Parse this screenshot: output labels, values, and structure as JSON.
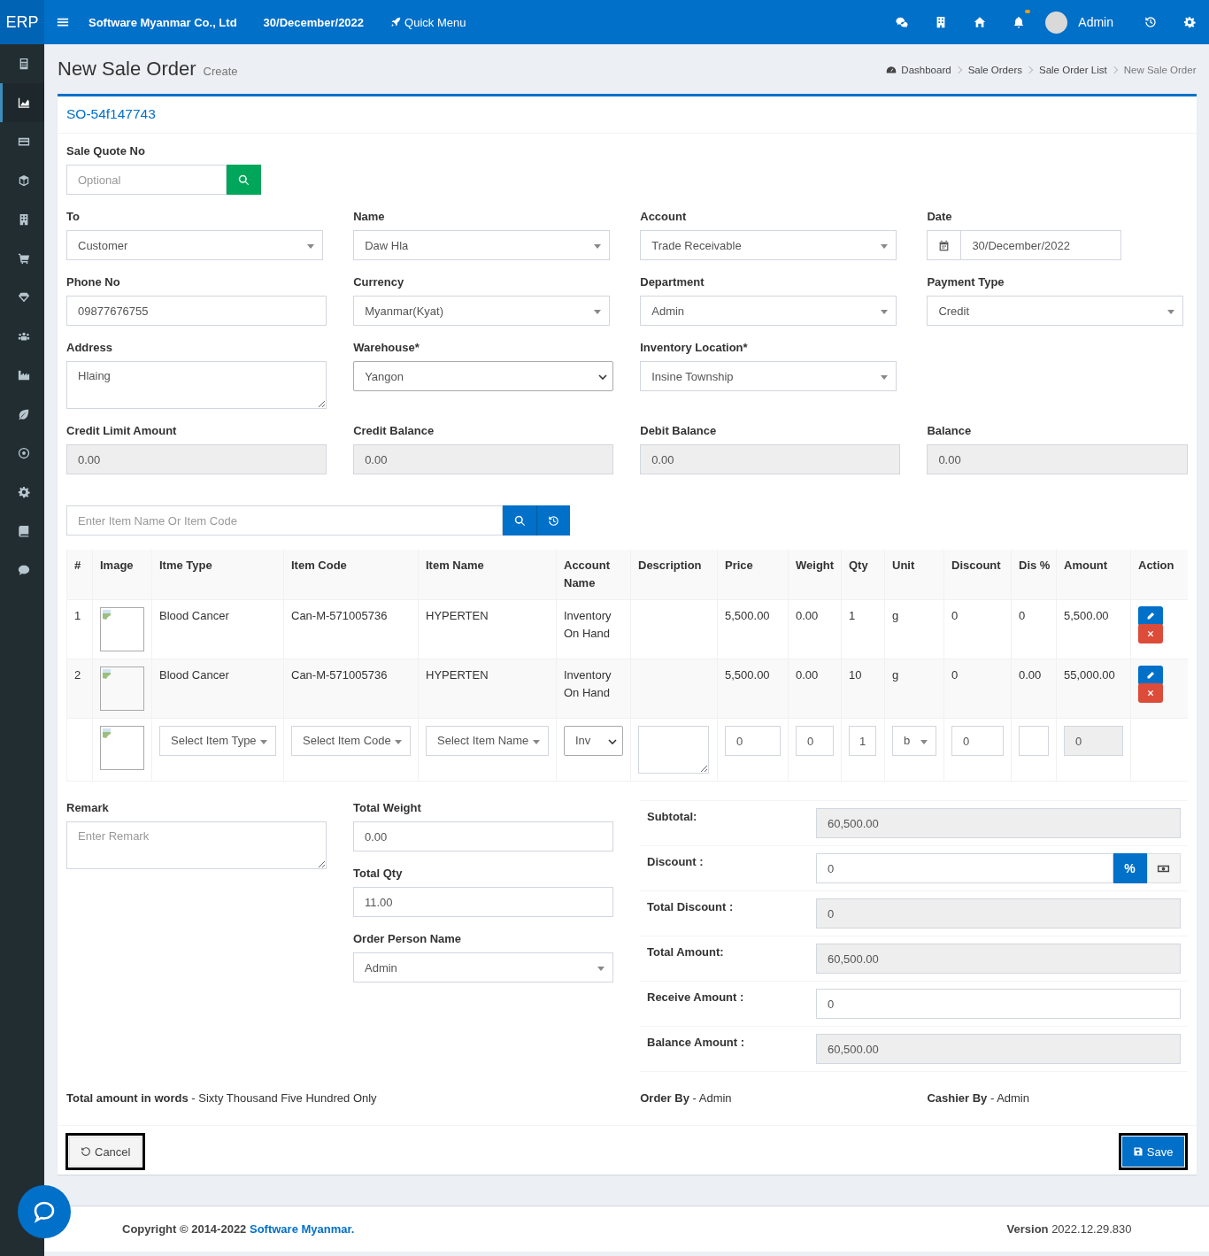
{
  "header": {
    "brand": "ERP",
    "company": "Software Myanmar Co., Ltd",
    "date": "30/December/2022",
    "quick_menu": "Quick Menu",
    "user": "Admin"
  },
  "sidebar": {
    "items": [
      {
        "kind": "calculator",
        "selected": false
      },
      {
        "kind": "area-chart",
        "selected": true
      },
      {
        "kind": "credit-card",
        "selected": false
      },
      {
        "kind": "cube",
        "selected": false
      },
      {
        "kind": "building",
        "selected": false
      },
      {
        "kind": "cart",
        "selected": false
      },
      {
        "kind": "diamond",
        "selected": false
      },
      {
        "kind": "users",
        "selected": false
      },
      {
        "kind": "factory",
        "selected": false
      },
      {
        "kind": "leaf",
        "selected": false
      },
      {
        "kind": "ball",
        "selected": false
      },
      {
        "kind": "gear",
        "selected": false
      },
      {
        "kind": "book",
        "selected": false
      },
      {
        "kind": "comment",
        "selected": false
      }
    ]
  },
  "page": {
    "title": "New Sale Order",
    "subtitle": "Create",
    "breadcrumb": [
      "Dashboard",
      "Sale Orders",
      "Sale Order List",
      "New Sale Order"
    ]
  },
  "order_no": "SO-54f147743",
  "sale_quote": {
    "label": "Sale Quote No",
    "placeholder": "Optional"
  },
  "field_rows": [
    [
      {
        "label": "To",
        "kind": "select",
        "value": "Customer"
      },
      {
        "label": "Name",
        "kind": "select",
        "value": "Daw Hla"
      },
      {
        "label": "Account",
        "kind": "select",
        "value": "Trade Receivable"
      },
      {
        "label": "Date",
        "kind": "date",
        "value": "30/December/2022"
      }
    ],
    [
      {
        "label": "Phone No",
        "kind": "input",
        "value": "09877676755"
      },
      {
        "label": "Currency",
        "kind": "select",
        "value": "Myanmar(Kyat)"
      },
      {
        "label": "Department",
        "kind": "select",
        "value": "Admin"
      },
      {
        "label": "Payment Type",
        "kind": "select",
        "value": "Credit"
      }
    ],
    [
      {
        "label": "Address",
        "kind": "textarea",
        "value": "Hlaing"
      },
      {
        "label": "Warehouse*",
        "kind": "native",
        "value": "Yangon"
      },
      {
        "label": "Inventory Location*",
        "kind": "select",
        "value": "Insine Township"
      }
    ],
    [
      {
        "label": "Credit Limit Amount",
        "kind": "readonly",
        "value": "0.00"
      },
      {
        "label": "Credit Balance",
        "kind": "readonly",
        "value": "0.00"
      },
      {
        "label": "Debit Balance",
        "kind": "readonly",
        "value": "0.00"
      },
      {
        "label": "Balance",
        "kind": "readonly",
        "value": "0.00"
      }
    ]
  ],
  "item_search": {
    "placeholder": "Enter Item Name Or Item Code"
  },
  "table": {
    "columns": [
      "#",
      "Image",
      "Itme Type",
      "Item Code",
      "Item Name",
      "Account Name",
      "Description",
      "Price",
      "Weight",
      "Qty",
      "Unit",
      "Discount",
      "Dis %",
      "Amount",
      "Action"
    ],
    "rows": [
      {
        "no": "1",
        "item_type": "Blood Cancer",
        "item_code": "Can-M-571005736",
        "item_name": "HYPERTEN",
        "account": "Inventory On Hand",
        "price": "5,500.00",
        "weight": "0.00",
        "qty": "1",
        "unit": "g",
        "discount": "0",
        "dis_percent": "0",
        "amount": "5,500.00"
      },
      {
        "no": "2",
        "item_type": "Blood Cancer",
        "item_code": "Can-M-571005736",
        "item_name": "HYPERTEN",
        "account": "Inventory On Hand",
        "price": "5,500.00",
        "weight": "0.00",
        "qty": "10",
        "unit": "g",
        "discount": "0",
        "dis_percent": "0.00",
        "amount": "55,000.00"
      }
    ],
    "entry_row": {
      "item_type": "Select Item Type",
      "item_code": "Select Item Code",
      "item_name": "Select Item Name",
      "account": "Inv",
      "price": "0",
      "weight": "0",
      "qty": "1",
      "unit": "b",
      "discount": "0",
      "amount": "0"
    }
  },
  "remark": {
    "label": "Remark",
    "placeholder": "Enter Remark"
  },
  "totals": [
    {
      "label": "Total Weight",
      "kind": "input",
      "value": "0.00"
    },
    {
      "label": "Total Qty",
      "kind": "input",
      "value": "11.00"
    },
    {
      "label": "Order Person Name",
      "kind": "select",
      "value": "Admin"
    }
  ],
  "summary": [
    {
      "label": "Subtotal:",
      "kind": "readonly",
      "value": "60,500.00"
    },
    {
      "label": "Discount :",
      "kind": "discount",
      "value": "0",
      "toggles": [
        {
          "kind": "percent",
          "label": "%",
          "selected": true
        },
        {
          "kind": "money",
          "selected": false
        }
      ]
    },
    {
      "label": "Total Discount :",
      "kind": "readonly",
      "value": "0"
    },
    {
      "label": "Total Amount:",
      "kind": "readonly",
      "value": "60,500.00"
    },
    {
      "label": "Receive Amount :",
      "kind": "input",
      "value": "0"
    },
    {
      "label": "Balance Amount :",
      "kind": "readonly",
      "value": "60,500.00"
    }
  ],
  "info_line": [
    "**Total amount in words** - Sixty Thousand Five Hundred Only",
    "**Order By** - Admin",
    "**Cashier By** - Admin"
  ],
  "buttons": {
    "cancel": "Cancel",
    "save": "Save"
  },
  "footer": {
    "copyright": "Copyright © 2014-2022",
    "company": "Software Myanmar.",
    "version": "**Version** 2022.12.29.830"
  }
}
